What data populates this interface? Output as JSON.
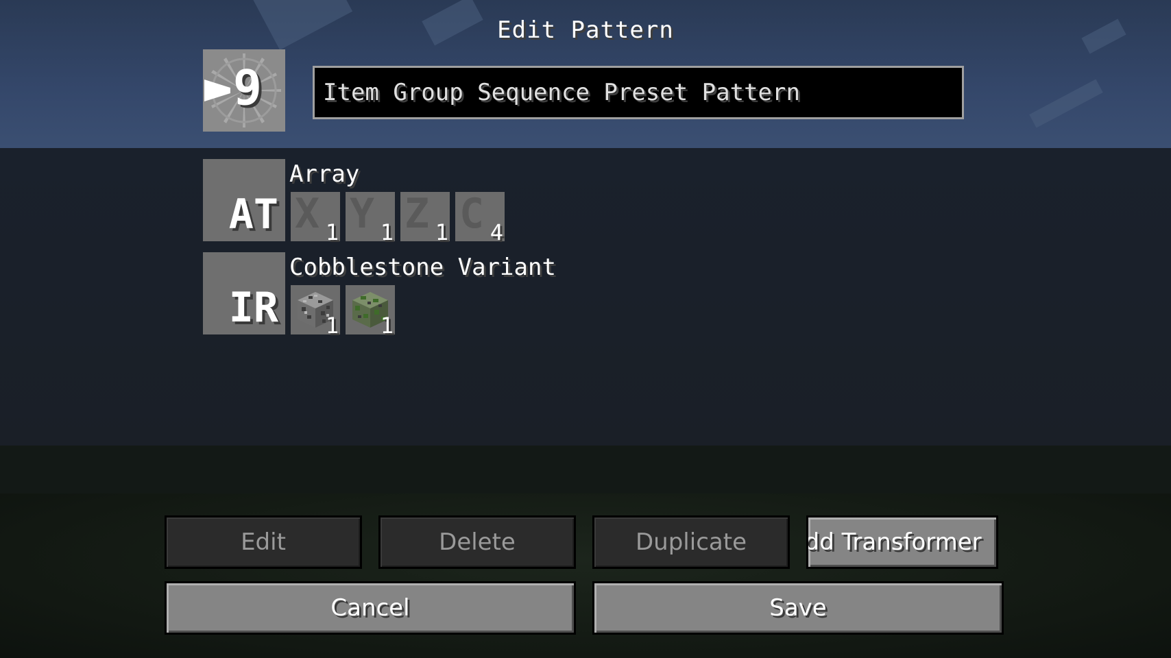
{
  "screen": {
    "title": "Edit Pattern",
    "pattern_icon_number": "9"
  },
  "name_field": {
    "value": "Item Group Sequence Preset Pattern"
  },
  "transformers": [
    {
      "abbr": "AT",
      "name": "Array",
      "slots": [
        {
          "glyph": "X",
          "count": "1"
        },
        {
          "glyph": "Y",
          "count": "1"
        },
        {
          "glyph": "Z",
          "count": "1"
        },
        {
          "glyph": "C",
          "count": "4"
        }
      ]
    },
    {
      "abbr": "IR",
      "name": "Cobblestone Variant",
      "slots": [
        {
          "item": "cobblestone-block-icon",
          "count": "1"
        },
        {
          "item": "mossy-cobblestone-block-icon",
          "count": "1"
        }
      ]
    }
  ],
  "buttons": {
    "edit": "Edit",
    "delete": "Delete",
    "duplicate": "Duplicate",
    "add_transformer": "Add Transformer",
    "cancel": "Cancel",
    "save": "Save"
  },
  "colors": {
    "sky": "#34476a",
    "overlay": "#1a1f27",
    "slot": "#6c6c6c",
    "button_enabled": "#858585",
    "button_disabled": "#2b2b2b"
  }
}
